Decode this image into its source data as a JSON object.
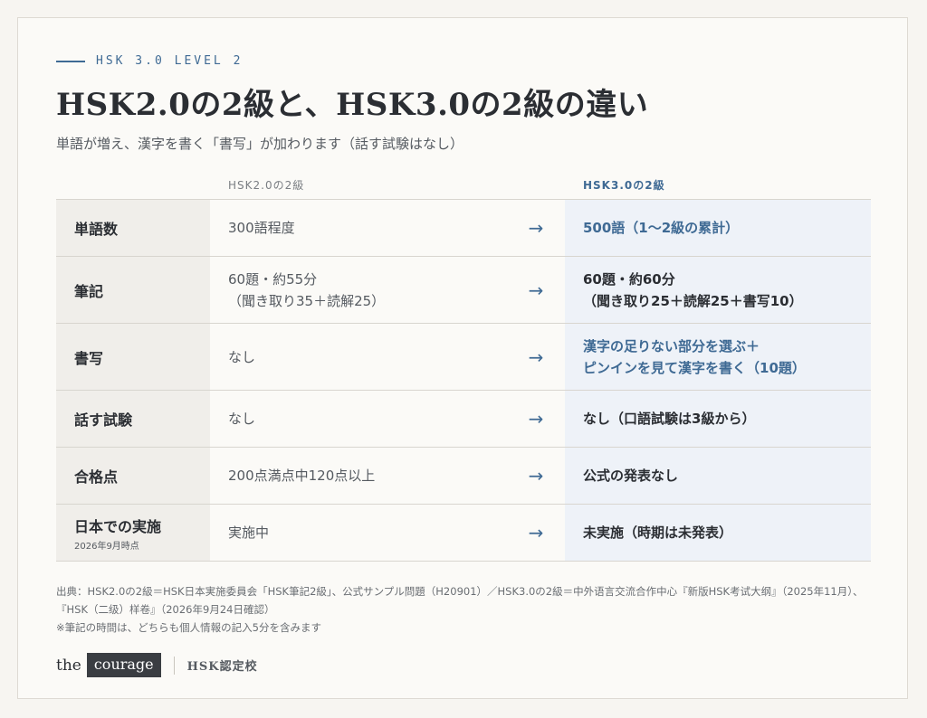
{
  "eyebrow": "HSK 3.0 LEVEL 2",
  "title": "HSK2.0の2級と、HSK3.0の2級の違い",
  "subtitle": "単語が増え、漢字を書く「書写」が加わります（話す試験はなし）",
  "columns": {
    "old": "HSK2.0の2級",
    "new": "HSK3.0の2級"
  },
  "arrow": "→",
  "rows": [
    {
      "label": "単語数",
      "note": "",
      "old": "300語程度",
      "new": "500語（1〜2級の累計）"
    },
    {
      "label": "筆記",
      "note": "",
      "old": "60題・約55分\n（聞き取り35＋読解25）",
      "new": "60題・約60分\n（聞き取り25＋読解25＋書写10）"
    },
    {
      "label": "書写",
      "note": "",
      "old": "なし",
      "new": "漢字の足りない部分を選ぶ＋\nピンインを見て漢字を書く（10題）"
    },
    {
      "label": "話す試験",
      "note": "",
      "old": "なし",
      "new": "なし（口語試験は3級から）"
    },
    {
      "label": "合格点",
      "note": "",
      "old": "200点満点中120点以上",
      "new": "公式の発表なし"
    },
    {
      "label": "日本での実施",
      "note": "2026年9月時点",
      "old": "実施中",
      "new": "未実施（時期は未発表）"
    }
  ],
  "source_line1": "出典：HSK2.0の2級＝HSK日本実施委員会「HSK筆記2級」、公式サンプル問題（H20901）／HSK3.0の2級＝中外语言交流合作中心『新版HSK考试大纲』（2025年11月）、『HSK（二级）样卷』（2026年9月24日確認）",
  "source_line2": "※筆記の時間は、どちらも個人情報の記入5分を含みます",
  "footer": {
    "the": "the",
    "courage": "courage",
    "school": "HSK認定校"
  },
  "colors": {
    "accent": "#3f6a94",
    "text": "#2b2e33",
    "new_column_bg": "#eef2f8",
    "label_bg": "#f0eeea"
  }
}
